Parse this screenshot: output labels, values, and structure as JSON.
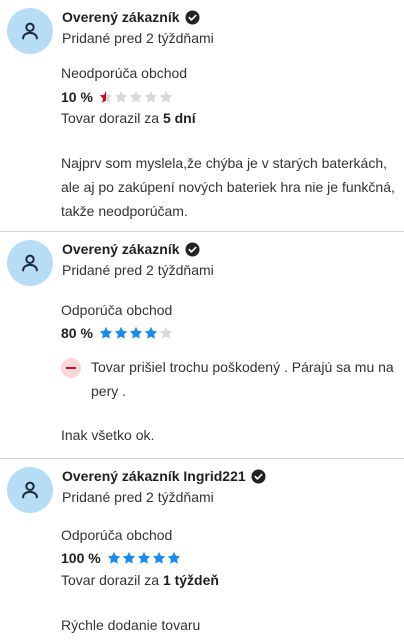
{
  "reviews": [
    {
      "author": "Overený zákazník",
      "posted": "Pridané pred 2 týždňami",
      "recommend": "Neodporúča obchod",
      "rating_pct": "10 %",
      "rating_value": 0.5,
      "delivery_prefix": "Tovar dorazil za ",
      "delivery_value": "5 dní",
      "text": "Najprv som myslela,že chýba je v starých baterkách, ale aj po zakúpení nových bateriek hra nie je funkčná, takže neodporúčam."
    },
    {
      "author": "Overený zákazník",
      "posted": "Pridané pred 2 týždňami",
      "recommend": "Odporúča obchod",
      "rating_pct": "80 %",
      "rating_value": 4,
      "con": "Tovar prišiel trochu poškodený . Párajú sa mu na pery .",
      "text": "Inak všetko ok."
    },
    {
      "author": "Overený zákazník Ingrid221",
      "posted": "Pridané pred 2 týždňami",
      "recommend": "Odporúča obchod",
      "rating_pct": "100 %",
      "rating_value": 5,
      "delivery_prefix": "Tovar dorazil za ",
      "delivery_value": "1 týždeň",
      "text": "Rýchle dodanie tovaru"
    }
  ],
  "colors": {
    "star_filled": "#1a8be8",
    "star_empty": "#d9d9d9",
    "star_bad": "#c0102c",
    "avatar_bg": "#b7dcf6",
    "con_badge": "#fcd6d9"
  },
  "icons": {
    "avatar": "user-icon",
    "verified": "check-badge-icon",
    "con": "minus-icon",
    "star": "star-icon"
  }
}
